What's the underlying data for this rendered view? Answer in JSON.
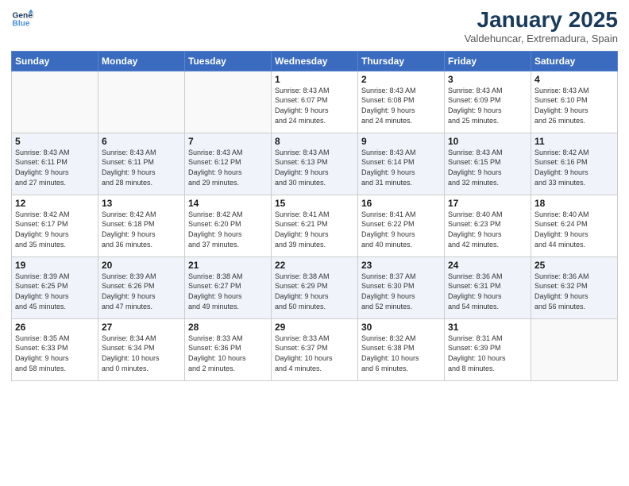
{
  "header": {
    "logo_line1": "General",
    "logo_line2": "Blue",
    "month": "January 2025",
    "location": "Valdehuncar, Extremadura, Spain"
  },
  "weekdays": [
    "Sunday",
    "Monday",
    "Tuesday",
    "Wednesday",
    "Thursday",
    "Friday",
    "Saturday"
  ],
  "weeks": [
    [
      {
        "day": "",
        "info": ""
      },
      {
        "day": "",
        "info": ""
      },
      {
        "day": "",
        "info": ""
      },
      {
        "day": "1",
        "info": "Sunrise: 8:43 AM\nSunset: 6:07 PM\nDaylight: 9 hours\nand 24 minutes."
      },
      {
        "day": "2",
        "info": "Sunrise: 8:43 AM\nSunset: 6:08 PM\nDaylight: 9 hours\nand 24 minutes."
      },
      {
        "day": "3",
        "info": "Sunrise: 8:43 AM\nSunset: 6:09 PM\nDaylight: 9 hours\nand 25 minutes."
      },
      {
        "day": "4",
        "info": "Sunrise: 8:43 AM\nSunset: 6:10 PM\nDaylight: 9 hours\nand 26 minutes."
      }
    ],
    [
      {
        "day": "5",
        "info": "Sunrise: 8:43 AM\nSunset: 6:11 PM\nDaylight: 9 hours\nand 27 minutes."
      },
      {
        "day": "6",
        "info": "Sunrise: 8:43 AM\nSunset: 6:11 PM\nDaylight: 9 hours\nand 28 minutes."
      },
      {
        "day": "7",
        "info": "Sunrise: 8:43 AM\nSunset: 6:12 PM\nDaylight: 9 hours\nand 29 minutes."
      },
      {
        "day": "8",
        "info": "Sunrise: 8:43 AM\nSunset: 6:13 PM\nDaylight: 9 hours\nand 30 minutes."
      },
      {
        "day": "9",
        "info": "Sunrise: 8:43 AM\nSunset: 6:14 PM\nDaylight: 9 hours\nand 31 minutes."
      },
      {
        "day": "10",
        "info": "Sunrise: 8:43 AM\nSunset: 6:15 PM\nDaylight: 9 hours\nand 32 minutes."
      },
      {
        "day": "11",
        "info": "Sunrise: 8:42 AM\nSunset: 6:16 PM\nDaylight: 9 hours\nand 33 minutes."
      }
    ],
    [
      {
        "day": "12",
        "info": "Sunrise: 8:42 AM\nSunset: 6:17 PM\nDaylight: 9 hours\nand 35 minutes."
      },
      {
        "day": "13",
        "info": "Sunrise: 8:42 AM\nSunset: 6:18 PM\nDaylight: 9 hours\nand 36 minutes."
      },
      {
        "day": "14",
        "info": "Sunrise: 8:42 AM\nSunset: 6:20 PM\nDaylight: 9 hours\nand 37 minutes."
      },
      {
        "day": "15",
        "info": "Sunrise: 8:41 AM\nSunset: 6:21 PM\nDaylight: 9 hours\nand 39 minutes."
      },
      {
        "day": "16",
        "info": "Sunrise: 8:41 AM\nSunset: 6:22 PM\nDaylight: 9 hours\nand 40 minutes."
      },
      {
        "day": "17",
        "info": "Sunrise: 8:40 AM\nSunset: 6:23 PM\nDaylight: 9 hours\nand 42 minutes."
      },
      {
        "day": "18",
        "info": "Sunrise: 8:40 AM\nSunset: 6:24 PM\nDaylight: 9 hours\nand 44 minutes."
      }
    ],
    [
      {
        "day": "19",
        "info": "Sunrise: 8:39 AM\nSunset: 6:25 PM\nDaylight: 9 hours\nand 45 minutes."
      },
      {
        "day": "20",
        "info": "Sunrise: 8:39 AM\nSunset: 6:26 PM\nDaylight: 9 hours\nand 47 minutes."
      },
      {
        "day": "21",
        "info": "Sunrise: 8:38 AM\nSunset: 6:27 PM\nDaylight: 9 hours\nand 49 minutes."
      },
      {
        "day": "22",
        "info": "Sunrise: 8:38 AM\nSunset: 6:29 PM\nDaylight: 9 hours\nand 50 minutes."
      },
      {
        "day": "23",
        "info": "Sunrise: 8:37 AM\nSunset: 6:30 PM\nDaylight: 9 hours\nand 52 minutes."
      },
      {
        "day": "24",
        "info": "Sunrise: 8:36 AM\nSunset: 6:31 PM\nDaylight: 9 hours\nand 54 minutes."
      },
      {
        "day": "25",
        "info": "Sunrise: 8:36 AM\nSunset: 6:32 PM\nDaylight: 9 hours\nand 56 minutes."
      }
    ],
    [
      {
        "day": "26",
        "info": "Sunrise: 8:35 AM\nSunset: 6:33 PM\nDaylight: 9 hours\nand 58 minutes."
      },
      {
        "day": "27",
        "info": "Sunrise: 8:34 AM\nSunset: 6:34 PM\nDaylight: 10 hours\nand 0 minutes."
      },
      {
        "day": "28",
        "info": "Sunrise: 8:33 AM\nSunset: 6:36 PM\nDaylight: 10 hours\nand 2 minutes."
      },
      {
        "day": "29",
        "info": "Sunrise: 8:33 AM\nSunset: 6:37 PM\nDaylight: 10 hours\nand 4 minutes."
      },
      {
        "day": "30",
        "info": "Sunrise: 8:32 AM\nSunset: 6:38 PM\nDaylight: 10 hours\nand 6 minutes."
      },
      {
        "day": "31",
        "info": "Sunrise: 8:31 AM\nSunset: 6:39 PM\nDaylight: 10 hours\nand 8 minutes."
      },
      {
        "day": "",
        "info": ""
      }
    ]
  ]
}
